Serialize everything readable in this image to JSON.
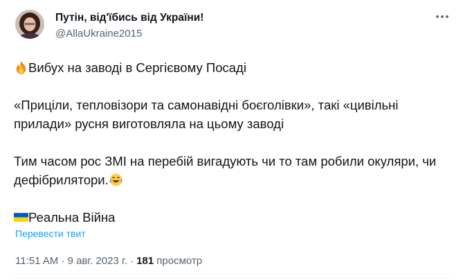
{
  "author": {
    "display_name": "Путін, від'їбись від України!",
    "handle": "@AllaUkraine2015"
  },
  "tweet": {
    "line1": "Вибух на заводі в Сергієвому Посаді",
    "line1_icon": "fire-emoji",
    "para2": "«Прицiли, тепловiзори та самонавiднi боєголiвки», такі «цивільні прилади» русня виготовляла на цьому заводі",
    "para3": "Тим часом рос ЗМІ на перебій вигадують чи то там робили окуляри, чи дефібрилятори.",
    "para3_icon": "laughing-crying-emoji",
    "signature": "Реальна Війна",
    "signature_icon": "ukraine-flag-emoji"
  },
  "translate_label": "Перевести твит",
  "meta": {
    "time": "11:51 AM",
    "sep1": "·",
    "date": "9 авг. 2023 г.",
    "sep2": "·",
    "views": "181",
    "views_label": "просмотр"
  },
  "colors": {
    "accent": "#1d9bf0",
    "secondary_text": "#536471",
    "primary_text": "#0f1419"
  }
}
